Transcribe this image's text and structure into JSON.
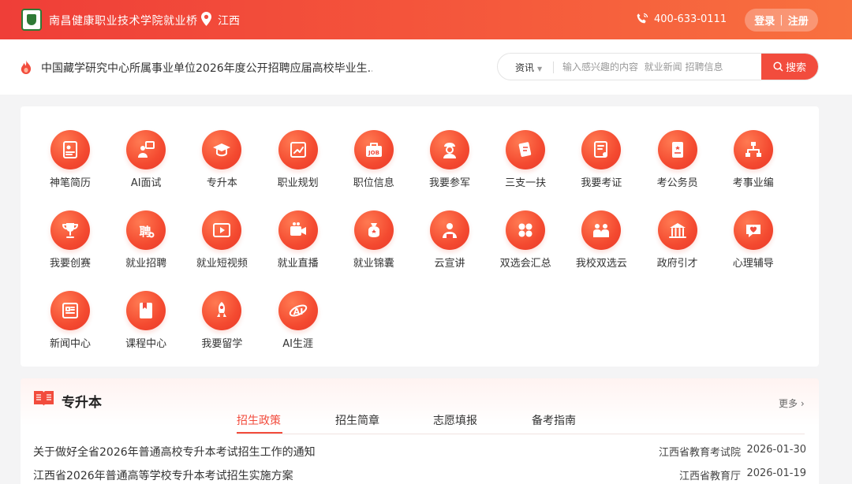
{
  "header": {
    "site_name": "南昌健康职业技术学院就业桥",
    "location": "江西",
    "phone": "400-633-0111",
    "login": "登录",
    "separator": "|",
    "register": "注册"
  },
  "notice": {
    "text": "中国藏学研究中心所属事业单位2026年度公开招聘应届高校毕业生..."
  },
  "search": {
    "category": "资讯",
    "placeholder": "输入感兴趣的内容  就业新闻 招聘信息",
    "button": "搜索"
  },
  "grid": {
    "items": [
      {
        "label": "神笔简历",
        "icon": "resume-icon"
      },
      {
        "label": "AI面试",
        "icon": "ai-interview-icon"
      },
      {
        "label": "专升本",
        "icon": "graduation-cap-icon"
      },
      {
        "label": "职业规划",
        "icon": "career-plan-icon"
      },
      {
        "label": "职位信息",
        "icon": "job-icon"
      },
      {
        "label": "我要参军",
        "icon": "soldier-icon"
      },
      {
        "label": "三支一扶",
        "icon": "support-icon"
      },
      {
        "label": "我要考证",
        "icon": "certificate-icon"
      },
      {
        "label": "考公务员",
        "icon": "civil-service-icon"
      },
      {
        "label": "考事业编",
        "icon": "org-chart-icon"
      },
      {
        "label": "我要创赛",
        "icon": "trophy-icon"
      },
      {
        "label": "就业招聘",
        "icon": "recruit-icon"
      },
      {
        "label": "就业短视频",
        "icon": "video-icon"
      },
      {
        "label": "就业直播",
        "icon": "live-camera-icon"
      },
      {
        "label": "就业锦囊",
        "icon": "tips-bag-icon"
      },
      {
        "label": "云宣讲",
        "icon": "presenter-icon"
      },
      {
        "label": "双选会汇总",
        "icon": "grid-summary-icon"
      },
      {
        "label": "我校双选云",
        "icon": "campus-fair-icon"
      },
      {
        "label": "政府引才",
        "icon": "government-icon"
      },
      {
        "label": "心理辅导",
        "icon": "heart-chat-icon"
      },
      {
        "label": "新闻中心",
        "icon": "news-icon"
      },
      {
        "label": "课程中心",
        "icon": "course-book-icon"
      },
      {
        "label": "我要留学",
        "icon": "rocket-icon"
      },
      {
        "label": "AI生涯",
        "icon": "ai-career-icon"
      }
    ]
  },
  "section": {
    "title": "专升本",
    "more": "更多",
    "tabs": [
      "招生政策",
      "招生简章",
      "志愿填报",
      "备考指南"
    ],
    "active_tab": 0,
    "rows": [
      {
        "title": "关于做好全省2026年普通高校专升本考试招生工作的通知",
        "source": "江西省教育考试院",
        "date": "2026-01-30"
      },
      {
        "title": "江西省2026年普通高等学校专升本考试招生实施方案",
        "source": "江西省教育厅",
        "date": "2026-01-19"
      }
    ]
  },
  "colors": {
    "brand_red": "#f24c3d",
    "header_gradient_start": "#ef3e38",
    "header_gradient_end": "#f8713f"
  }
}
